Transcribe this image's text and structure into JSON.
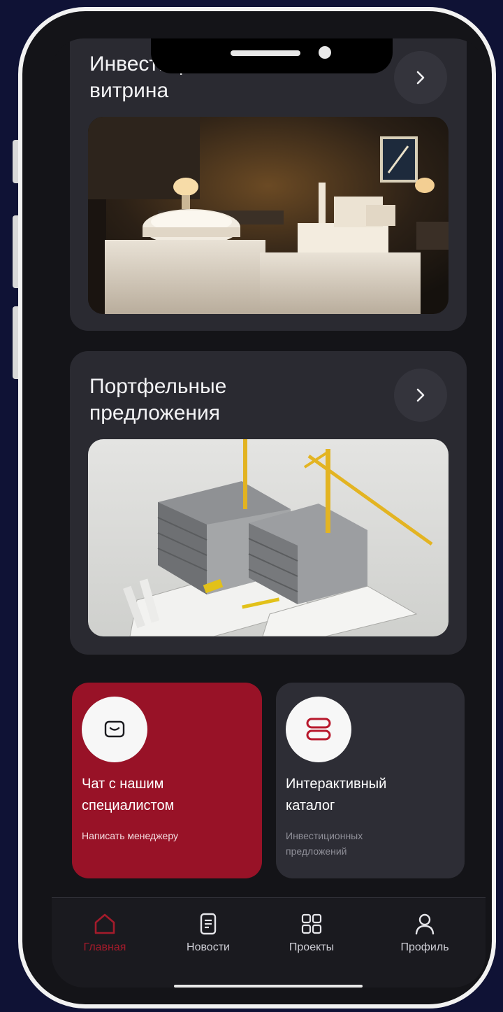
{
  "showcase_card": {
    "title": "Инвестиционная\nвитрина"
  },
  "portfolio_card": {
    "title": "Портфельные\nпредложения"
  },
  "chat_tile": {
    "title": "Чат с нашим\nспециалистом",
    "subtitle": "Написать менеджеру",
    "icon": "message-icon"
  },
  "catalog_tile": {
    "title": "Интерактивный\nкаталог",
    "subtitle": "Инвестиционных\nпредложений",
    "icon": "catalog-icon"
  },
  "nav": {
    "items": [
      {
        "label": "Главная",
        "icon": "home-icon",
        "active": true
      },
      {
        "label": "Новости",
        "icon": "news-icon",
        "active": false
      },
      {
        "label": "Проекты",
        "icon": "grid-icon",
        "active": false
      },
      {
        "label": "Профиль",
        "icon": "profile-icon",
        "active": false
      }
    ]
  },
  "colors": {
    "accent": "#981227",
    "active_nav": "#a41b2b",
    "card_bg": "#2a2a31",
    "page_bg": "#0f1235"
  }
}
